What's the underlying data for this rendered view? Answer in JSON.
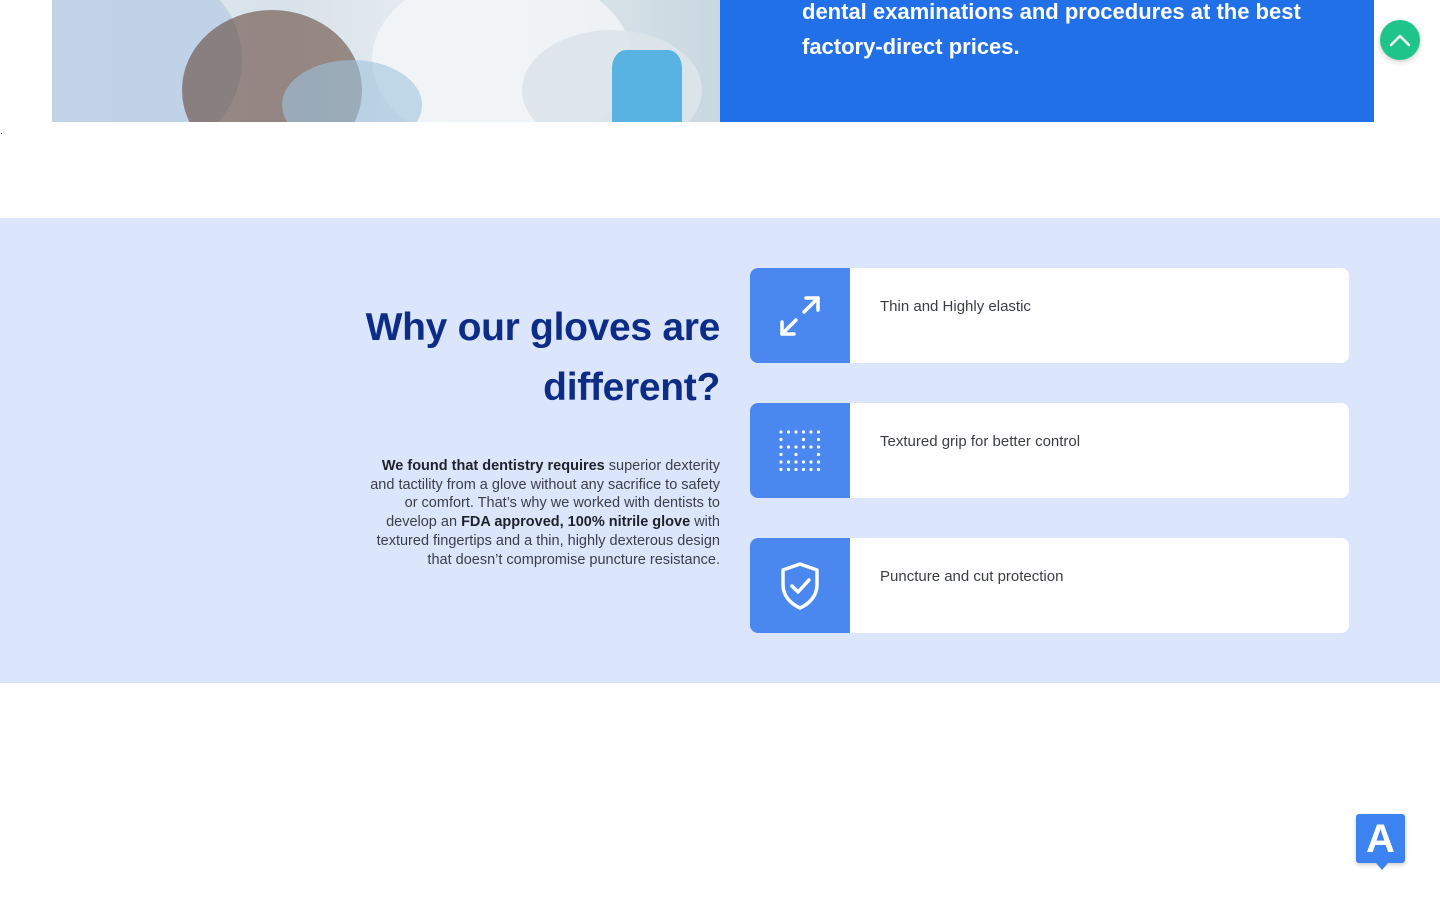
{
  "hero": {
    "text": "dental examinations and procedures at the best factory-direct prices."
  },
  "stray_mark": ".",
  "scroll_top": {
    "icon": "chevron-up-icon"
  },
  "features": {
    "headline": "Why our gloves are different?",
    "body": {
      "part1_bold": "We found that dentistry requires",
      "part2": " superior dexterity and tactility from a glove without any sacrifice to safety or comfort. That’s why we worked with dentists to develop an ",
      "part3_bold": "FDA approved, 100% nitrile glove",
      "part4": " with textured fingertips and a thin, highly dexterous design that doesn’t compromise puncture resistance."
    },
    "items": [
      {
        "label": "Thin and Highly elastic",
        "icon": "expand-arrows-icon"
      },
      {
        "label": "Textured grip for better control",
        "icon": "dot-grid-icon"
      },
      {
        "label": "Puncture and cut protection",
        "icon": "shield-check-icon"
      }
    ]
  },
  "badge": {
    "letter": "A",
    "icon": "accessibility-badge-icon"
  },
  "colors": {
    "hero_blue": "#2270e8",
    "section_bg": "#dbe6fd",
    "headline": "#0d2c86",
    "icon_box": "#4a88f0",
    "scroll_top": "#1fc48a"
  }
}
